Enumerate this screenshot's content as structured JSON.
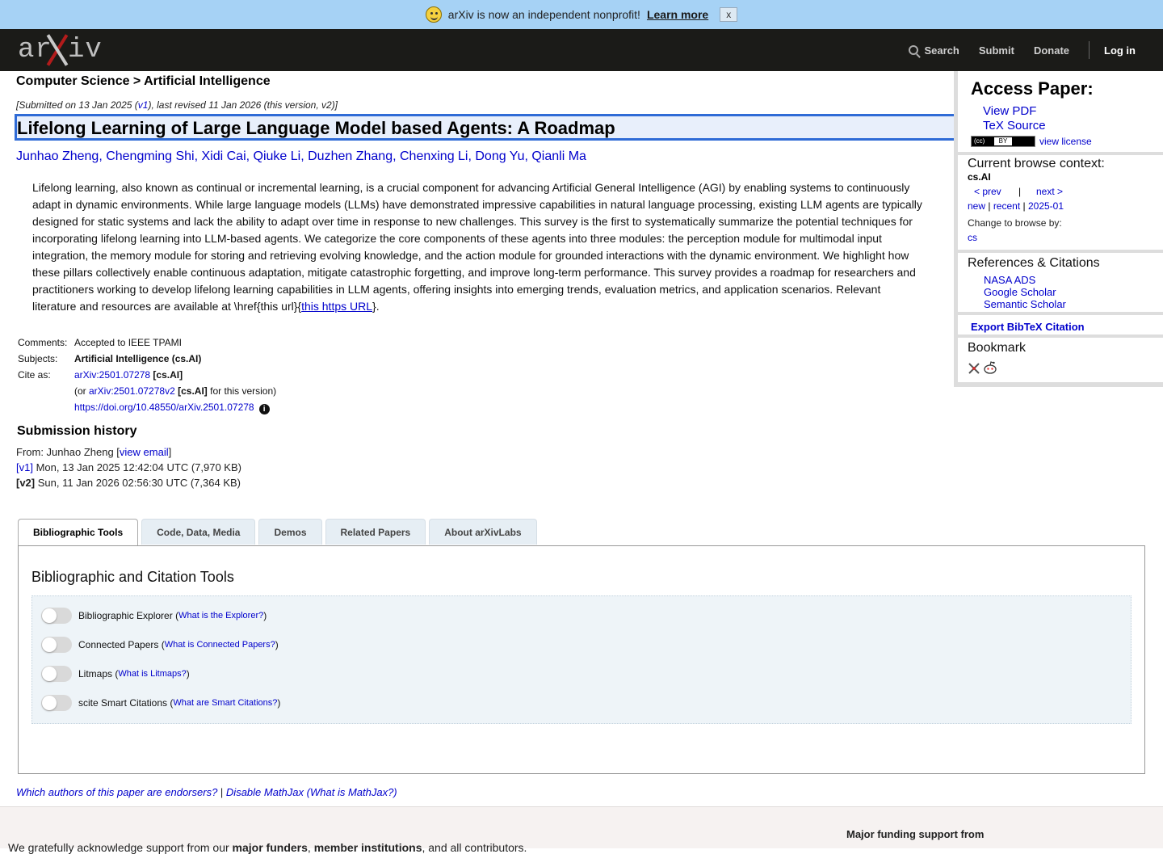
{
  "banner": {
    "text": "arXiv is now an independent nonprofit!",
    "learn_more": "Learn more",
    "close": "x",
    "colors": {
      "background": "#a6d2f5"
    }
  },
  "header": {
    "logo_text": "arXiv",
    "nav": {
      "search": "Search",
      "submit": "Submit",
      "donate": "Donate",
      "login": "Log in"
    },
    "colors": {
      "background": "#1b1b18",
      "logo_accent": "#b31b1b"
    }
  },
  "breadcrumb": "Computer Science > Artificial Intelligence",
  "dateline": {
    "prefix": "[Submitted on 13 Jan 2025 (",
    "v1": "v1",
    "suffix": "), last revised 11 Jan 2026 (this version, v2)]"
  },
  "title": "Lifelong Learning of Large Language Model based Agents: A Roadmap",
  "authors": [
    "Junhao Zheng",
    "Chengming Shi",
    "Xidi Cai",
    "Qiuke Li",
    "Duzhen Zhang",
    "Chenxing Li",
    "Dong Yu",
    "Qianli Ma"
  ],
  "abstract": {
    "text": "Lifelong learning, also known as continual or incremental learning, is a crucial component for advancing Artificial General Intelligence (AGI) by enabling systems to continuously adapt in dynamic environments. While large language models (LLMs) have demonstrated impressive capabilities in natural language processing, existing LLM agents are typically designed for static systems and lack the ability to adapt over time in response to new challenges. This survey is the first to systematically summarize the potential techniques for incorporating lifelong learning into LLM-based agents. We categorize the core components of these agents into three modules: the perception module for multimodal input integration, the memory module for storing and retrieving evolving knowledge, and the action module for grounded interactions with the dynamic environment. We highlight how these pillars collectively enable continuous adaptation, mitigate catastrophic forgetting, and improve long-term performance. This survey provides a roadmap for researchers and practitioners working to develop lifelong learning capabilities in LLM agents, offering insights into emerging trends, evaluation metrics, and application scenarios. Relevant literature and resources are available at \\href{this url}{",
    "link": "this https URL",
    "end": "}."
  },
  "meta": {
    "comments_label": "Comments:",
    "comments": "Accepted to IEEE TPAMI",
    "subjects_label": "Subjects:",
    "subjects": "Artificial Intelligence (cs.AI)",
    "cite_label": "Cite as:",
    "cite_id": "arXiv:2501.07278",
    "cite_cat": "[cs.AI]",
    "version_prefix": "(or ",
    "version_id": "arXiv:2501.07278v2",
    "version_cat": "[cs.AI]",
    "version_suffix": " for this version)",
    "doi": "https://doi.org/10.48550/arXiv.2501.07278",
    "info": "i"
  },
  "history": {
    "title": "Submission history",
    "from_prefix": "From: Junhao Zheng [",
    "view_email": "view email",
    "from_suffix": "]",
    "v1_label": "[v1]",
    "v1_text": " Mon, 13 Jan 2025 12:42:04 UTC (7,970 KB)",
    "v2_label": "[v2]",
    "v2_text": " Sun, 11 Jan 2026 02:56:30 UTC (7,364 KB)"
  },
  "tabs": [
    "Bibliographic Tools",
    "Code, Data, Media",
    "Demos",
    "Related Papers",
    "About arXivLabs"
  ],
  "tools": {
    "title": "Bibliographic and Citation Tools",
    "items": [
      {
        "label": "Bibliographic Explorer",
        "help": "What is the Explorer?"
      },
      {
        "label": "Connected Papers",
        "help": "What is Connected Papers?"
      },
      {
        "label": "Litmaps",
        "help": "What is Litmaps?"
      },
      {
        "label": "scite Smart Citations",
        "help": "What are Smart Citations?"
      }
    ]
  },
  "endorsers": {
    "which": "Which authors of this paper are endorsers?",
    "sep": " | ",
    "disable": "Disable MathJax",
    "what": "(What is MathJax?)"
  },
  "footer": {
    "ack_prefix": "We gratefully acknowledge support from our ",
    "major_funders": "major funders",
    "member_institutions": "member institutions",
    "ack_suffix": ", and all contributors.",
    "funding": "Major funding support from"
  },
  "sidebar": {
    "access_title": "Access Paper:",
    "view_pdf": "View PDF",
    "tex_source": "TeX Source",
    "view_license": "view license",
    "context_title": "Current browse context:",
    "context": "cs.AI",
    "prev": "< prev",
    "bar": "|",
    "next": "next >",
    "new": "new",
    "recent": "recent",
    "month": "2025-01",
    "change_label": "Change to browse by:",
    "cs": "cs",
    "refs_title": "References & Citations",
    "nasa": "NASA ADS",
    "scholar": "Google Scholar",
    "semantic": "Semantic Scholar",
    "bibtex": "Export BibTeX Citation",
    "bookmark_title": "Bookmark"
  }
}
